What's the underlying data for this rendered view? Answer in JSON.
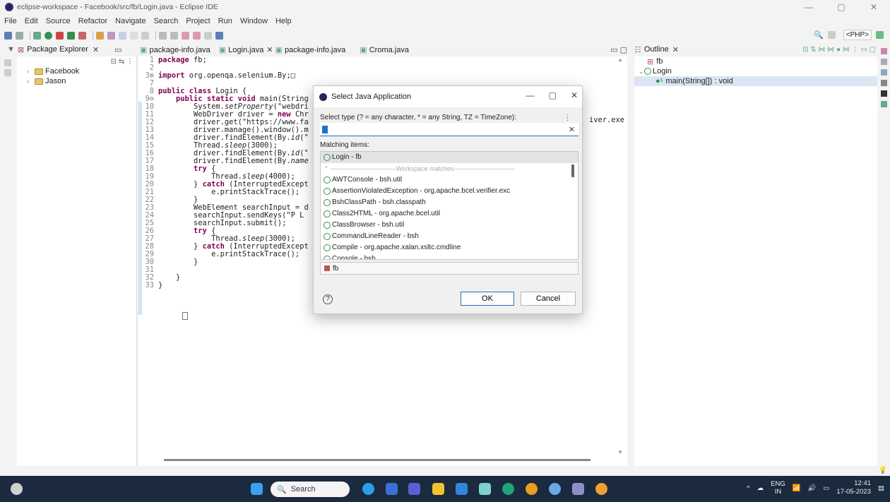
{
  "window": {
    "title": "eclipse-workspace - Facebook/src/fb/Login.java - Eclipse IDE",
    "controls": [
      "—",
      "▢",
      "✕"
    ]
  },
  "menu": [
    "File",
    "Edit",
    "Source",
    "Refactor",
    "Navigate",
    "Search",
    "Project",
    "Run",
    "Window",
    "Help"
  ],
  "toolbar": {
    "perspective_label": "<PHP>"
  },
  "package_explorer": {
    "tab_label": "Package Explorer",
    "projects": [
      "Facebook",
      "Jason"
    ]
  },
  "editor": {
    "tabs": [
      "package-info.java",
      "Login.java",
      "package-info.java",
      "Croma.java"
    ],
    "lines": [
      {
        "n": "1",
        "html": "<span class=\"kw\">package</span> fb;"
      },
      {
        "n": "2",
        "html": ""
      },
      {
        "n": "3⊕",
        "html": "<span class=\"kw\">import</span> org.openqa.selenium.By;&#9633;"
      },
      {
        "n": "7",
        "html": ""
      },
      {
        "n": "8",
        "html": "<span class=\"kw\">public class</span> Login {"
      },
      {
        "n": "9⊖",
        "html": "    <span class=\"kw\">public static void</span> main(String"
      },
      {
        "n": "10",
        "html": "        System.<span class=\"it\">setProperty</span>(\"webdri"
      },
      {
        "n": "11",
        "html": "        WebDriver driver = <span class=\"kw\">new</span> Chr"
      },
      {
        "n": "12",
        "html": "        driver.get(\"https://www.fa"
      },
      {
        "n": "13",
        "html": "        driver.manage().window().m"
      },
      {
        "n": "14",
        "html": "        driver.findElement(By.<span class=\"it\">id</span>(\""
      },
      {
        "n": "15",
        "html": "        Thread.<span class=\"it\">sleep</span>(3000);"
      },
      {
        "n": "16",
        "html": "        driver.findElement(By.<span class=\"it\">id</span>(\""
      },
      {
        "n": "17",
        "html": "        driver.findElement(By.<span class=\"it\">name</span>"
      },
      {
        "n": "18",
        "html": "        <span class=\"kw\">try</span> {"
      },
      {
        "n": "19",
        "html": "            Thread.<span class=\"it\">sleep</span>(4000);"
      },
      {
        "n": "20",
        "html": "        } <span class=\"kw\">catch</span> (InterruptedExcept"
      },
      {
        "n": "21",
        "html": "            e.printStackTrace();"
      },
      {
        "n": "22",
        "html": "        }"
      },
      {
        "n": "23",
        "html": "        WebElement searchInput = d"
      },
      {
        "n": "24",
        "html": "        searchInput.sendKeys(\"P L"
      },
      {
        "n": "25",
        "html": "        searchInput.submit();"
      },
      {
        "n": "26",
        "html": "        <span class=\"kw\">try</span> {"
      },
      {
        "n": "27",
        "html": "            Thread.<span class=\"it\">sleep</span>(3000);"
      },
      {
        "n": "28",
        "html": "        } <span class=\"kw\">catch</span> (InterruptedExcept"
      },
      {
        "n": "29",
        "html": "            e.printStackTrace();"
      },
      {
        "n": "30",
        "html": "        }"
      },
      {
        "n": "31",
        "html": ""
      },
      {
        "n": "32",
        "html": "    }"
      },
      {
        "n": "33",
        "html": "}"
      }
    ],
    "overflow_text": "iver.exe"
  },
  "outline": {
    "tab_label": "Outline",
    "items": [
      "fb",
      "Login",
      "main(String[]) : void"
    ]
  },
  "dialog": {
    "title": "Select Java Application",
    "type_label": "Select type (? = any character, * = any String, TZ = TimeZone):",
    "input_value": "",
    "matching_label": "Matching items:",
    "items": [
      "Login - fb",
      "AWTConsole - bsh.util",
      "AssertionViolatedException - org.apache.bcel.verifier.exc",
      "BshClassPath - bsh.classpath",
      "Class2HTML - org.apache.bcel.util",
      "ClassBrowser - bsh.util",
      "CommandLineReader - bsh",
      "Compile - org.apache.xalan.xsltc.cmdline",
      "Console - bsh"
    ],
    "workspace_sep": "Workspace matches",
    "package": "fb",
    "help": "?",
    "ok_label": "OK",
    "cancel_label": "Cancel"
  },
  "taskbar": {
    "search_label": "Search",
    "lang_top": "ENG",
    "lang_bottom": "IN",
    "time": "12:41",
    "date": "17-05-2023"
  },
  "colors": {
    "accent": "#1a73c8",
    "keyword": "#7f0055",
    "string": "#2a00ff",
    "taskbar": "#1b2a3e"
  }
}
